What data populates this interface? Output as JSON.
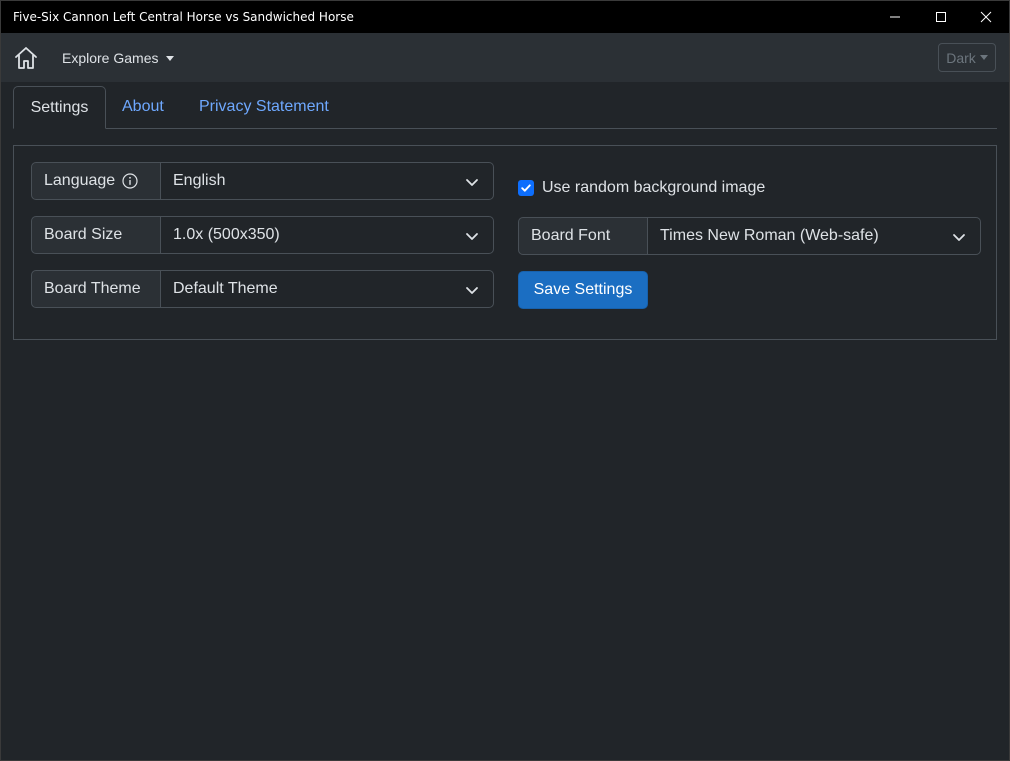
{
  "window": {
    "title": "Five-Six Cannon Left Central Horse vs Sandwiched Horse"
  },
  "navbar": {
    "explore_label": "Explore Games",
    "theme_label": "Dark"
  },
  "tabs": [
    {
      "label": "Settings",
      "active": true
    },
    {
      "label": "About",
      "active": false
    },
    {
      "label": "Privacy Statement",
      "active": false
    }
  ],
  "settings": {
    "language": {
      "label": "Language",
      "value": "English"
    },
    "board_size": {
      "label": "Board Size",
      "value": "1.0x (500x350)"
    },
    "board_theme": {
      "label": "Board Theme",
      "value": "Default Theme"
    },
    "random_bg": {
      "label": "Use random background image",
      "checked": true
    },
    "board_font": {
      "label": "Board Font",
      "value": "Times New Roman (Web-safe)"
    },
    "save_label": "Save Settings"
  },
  "colors": {
    "background": "#212529",
    "navbar": "#2b3035",
    "link": "#6ea8fe",
    "primary_button": "#1b6ec2",
    "checkbox": "#0d6efd"
  }
}
